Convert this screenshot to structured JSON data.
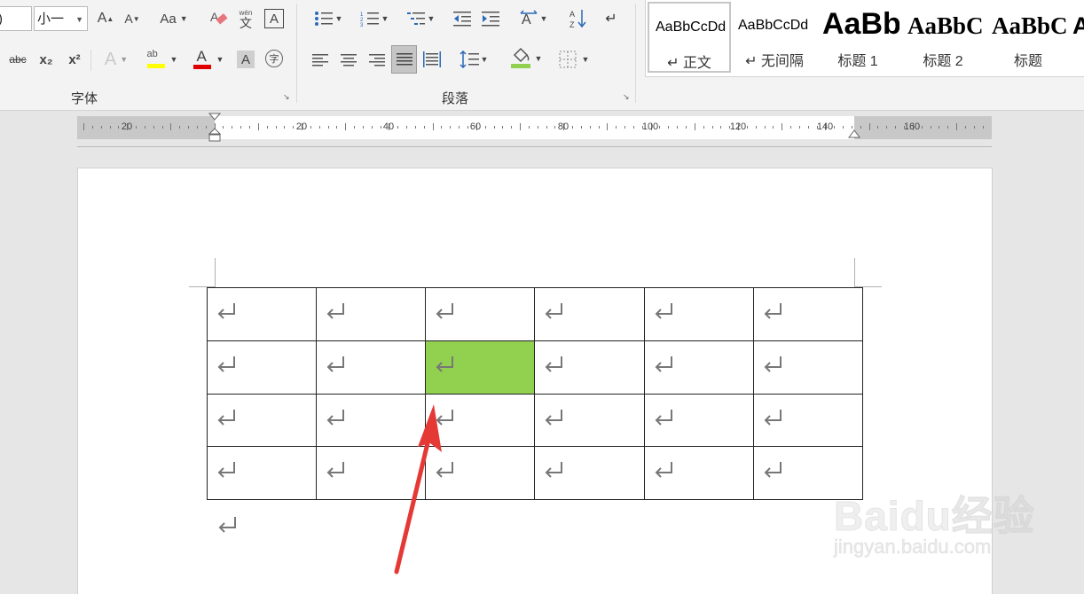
{
  "font": {
    "name_fragment": ")",
    "size": "小一",
    "group_label": "字体",
    "grow_label": "A",
    "shrink_label": "A",
    "case_label": "Aa",
    "phonetic_label": "wén",
    "phonetic_char": "文",
    "border_char_label": "A",
    "strike_label": "abc",
    "subscript_label": "x₂",
    "superscript_label": "x²",
    "effects_label": "A",
    "highlight_label": "ab",
    "font_color_label": "A",
    "shading_label": "A",
    "enclose_label": "字"
  },
  "paragraph": {
    "group_label": "段落"
  },
  "styles": [
    {
      "preview": "AaBbCcDd",
      "name": "↵ 正文"
    },
    {
      "preview": "AaBbCcDd",
      "name": "↵ 无间隔"
    },
    {
      "preview": "AaBb",
      "name": "标题 1"
    },
    {
      "preview": "AaBbC",
      "name": "标题 2"
    },
    {
      "preview": "AaBbC",
      "name": "标题"
    },
    {
      "preview": "A",
      "name": ""
    }
  ],
  "ruler": {
    "labels": [
      "20",
      "20",
      "40",
      "60",
      "80",
      "100",
      "120",
      "140",
      "160"
    ]
  },
  "table": {
    "rows": 4,
    "cols": 6,
    "highlighted_cell": {
      "row": 1,
      "col": 2
    },
    "highlight_color": "#92d050"
  },
  "colors": {
    "highlight_bar": "#ffff00",
    "font_color_bar": "#e00000",
    "shading_bar": "#92d050",
    "arrow": "#e53935"
  },
  "watermark": {
    "brand": "Baidu经验",
    "url": "jingyan.baidu.com"
  }
}
